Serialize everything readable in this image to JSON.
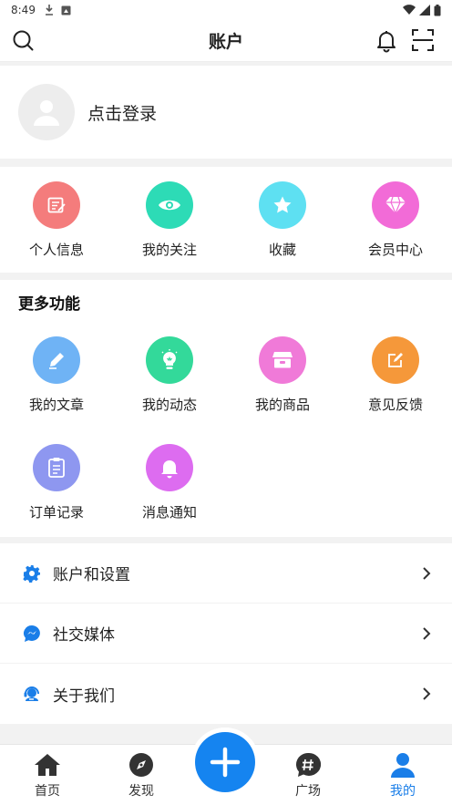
{
  "status": {
    "time": "8:49"
  },
  "header": {
    "title": "账户"
  },
  "login": {
    "label": "点击登录"
  },
  "quick": {
    "items": [
      {
        "label": "个人信息",
        "icon": "edit-icon",
        "color": "#f47c7c"
      },
      {
        "label": "我的关注",
        "icon": "eye-icon",
        "color": "#2ddbb6"
      },
      {
        "label": "收藏",
        "icon": "star-icon",
        "color": "#5ee0f2"
      },
      {
        "label": "会员中心",
        "icon": "diamond-icon",
        "color": "#f26bd7"
      }
    ]
  },
  "more": {
    "title": "更多功能",
    "items": [
      {
        "label": "我的文章",
        "icon": "pencil-icon",
        "color": "#6fb3f5"
      },
      {
        "label": "我的动态",
        "icon": "bulb-icon",
        "color": "#33d99a"
      },
      {
        "label": "我的商品",
        "icon": "shop-icon",
        "color": "#f07ad8"
      },
      {
        "label": "意见反馈",
        "icon": "feedback-icon",
        "color": "#f5983a"
      },
      {
        "label": "订单记录",
        "icon": "clipboard-icon",
        "color": "#8e97f0"
      },
      {
        "label": "消息通知",
        "icon": "bell-icon",
        "color": "#dd6cf0"
      }
    ]
  },
  "menu": {
    "items": [
      {
        "label": "账户和设置",
        "icon": "gear-icon"
      },
      {
        "label": "社交媒体",
        "icon": "chat-icon"
      },
      {
        "label": "关于我们",
        "icon": "support-icon"
      }
    ]
  },
  "nav": {
    "home": "首页",
    "discover": "发现",
    "square": "广场",
    "mine": "我的",
    "active_color": "#1a7ee8"
  }
}
